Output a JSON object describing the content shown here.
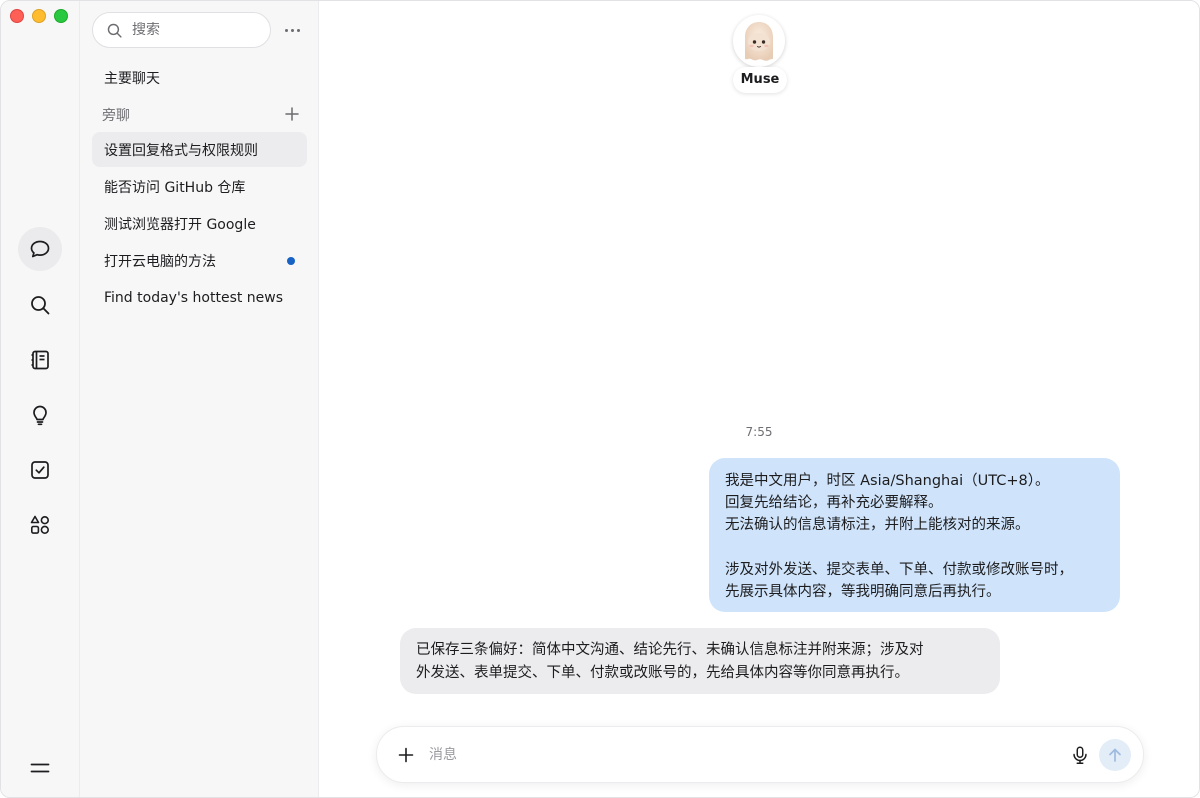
{
  "sidebar": {
    "search_placeholder": "搜索",
    "main_chat": "主要聊天",
    "section_label": "旁聊",
    "items": [
      {
        "label": "设置回复格式与权限规则",
        "selected": true,
        "unread": false
      },
      {
        "label": "能否访问 GitHub 仓库",
        "selected": false,
        "unread": false
      },
      {
        "label": "测试浏览器打开 Google",
        "selected": false,
        "unread": false
      },
      {
        "label": "打开云电脑的方法",
        "selected": false,
        "unread": true
      },
      {
        "label": "Find today's hottest news",
        "selected": false,
        "unread": false
      }
    ]
  },
  "rail": {
    "icons": [
      "chat-icon",
      "search-icon",
      "notebook-icon",
      "lightbulb-icon",
      "checkbox-icon",
      "apps-icon",
      "menu-icon"
    ]
  },
  "chat": {
    "assistant_name": "Muse",
    "time": "7:55",
    "user_message_lines": [
      "我是中文用户，时区 Asia/Shanghai（UTC+8）。",
      "回复先给结论，再补充必要解释。",
      "无法确认的信息请标注，并附上能核对的来源。",
      "",
      "涉及对外发送、提交表单、下单、付款或修改账号时，",
      "先展示具体内容，等我明确同意后再执行。"
    ],
    "assistant_message_lines": [
      "已保存三条偏好：简体中文沟通、结论先行、未确认信息标注并附来源；涉及对",
      "外发送、表单提交、下单、付款或改账号的，先给具体内容等你同意再执行。"
    ]
  },
  "composer": {
    "placeholder": "消息"
  },
  "colors": {
    "accent_dot": "#1762c5",
    "user_bubble": "#cfe4fb",
    "assistant_bubble": "#ececee"
  }
}
